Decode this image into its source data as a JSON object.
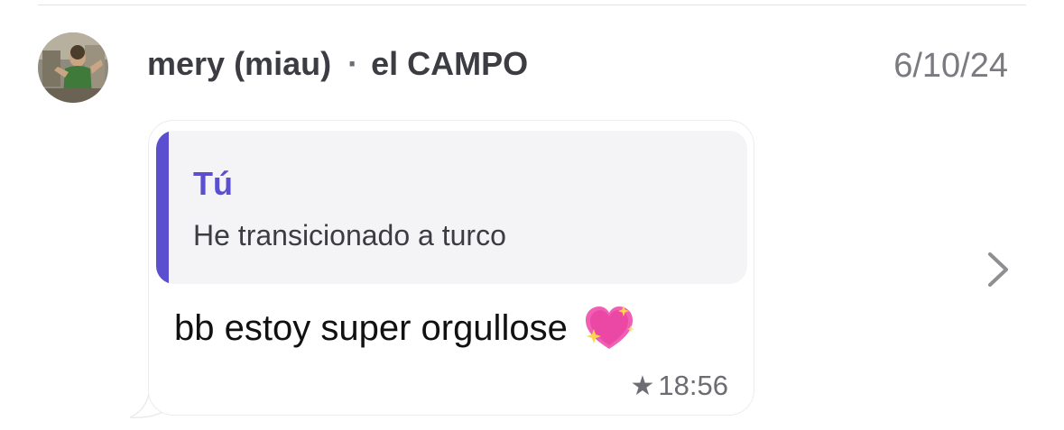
{
  "header": {
    "sender": "mery (miau)",
    "separator": "·",
    "group": "el CAMPO",
    "date": "6/10/24"
  },
  "quote": {
    "author": "Tú",
    "text": "He transicionado a turco"
  },
  "message": {
    "text": "bb estoy super orgullose",
    "emoji_icon": "sparkling-heart-icon",
    "star_glyph": "★",
    "time": "18:56"
  },
  "icons": {
    "avatar": "avatar-photo",
    "chevron": "chevron-right-icon"
  },
  "colors": {
    "accent": "#5b4fcf",
    "quote_bg": "#f4f3f5",
    "secondary_text": "#6c6c72"
  }
}
